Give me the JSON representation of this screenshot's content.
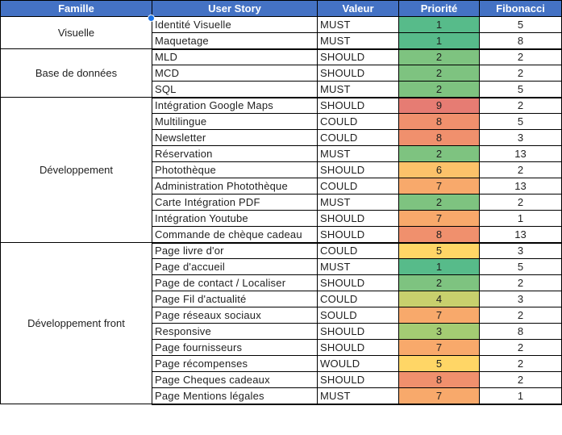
{
  "headers": {
    "famille": "Famille",
    "user_story": "User Story",
    "valeur": "Valeur",
    "priorite": "Priorité",
    "fibonacci": "Fibonacci"
  },
  "header_color": "#4472c4",
  "priority_colors": {
    "1": "#57bb8a",
    "2": "#7ec380",
    "3": "#a4cc73",
    "4": "#c8d06d",
    "5": "#ffd666",
    "6": "#fcc26a",
    "7": "#f8a96b",
    "8": "#f0906d",
    "9": "#e67c73"
  },
  "groups": [
    {
      "famille": "Visuelle",
      "rows": [
        {
          "story": "Identité Visuelle",
          "valeur": "MUST",
          "priorite": "1",
          "fibonacci": "5"
        },
        {
          "story": "Maquetage",
          "valeur": "MUST",
          "priorite": "1",
          "fibonacci": "8"
        }
      ]
    },
    {
      "famille": "Base de données",
      "rows": [
        {
          "story": "MLD",
          "valeur": "SHOULD",
          "priorite": "2",
          "fibonacci": "2"
        },
        {
          "story": "MCD",
          "valeur": "SHOULD",
          "priorite": "2",
          "fibonacci": "2"
        },
        {
          "story": "SQL",
          "valeur": "MUST",
          "priorite": "2",
          "fibonacci": "5"
        }
      ]
    },
    {
      "famille": "Développement",
      "rows": [
        {
          "story": "Intégration Google Maps",
          "valeur": "SHOULD",
          "priorite": "9",
          "fibonacci": "2"
        },
        {
          "story": "Multilingue",
          "valeur": "COULD",
          "priorite": "8",
          "fibonacci": "5"
        },
        {
          "story": "Newsletter",
          "valeur": "COULD",
          "priorite": "8",
          "fibonacci": "3"
        },
        {
          "story": "Réservation",
          "valeur": "MUST",
          "priorite": "2",
          "fibonacci": "13"
        },
        {
          "story": "Photothèque",
          "valeur": "SHOULD",
          "priorite": "6",
          "fibonacci": "2"
        },
        {
          "story": "Administration Photothèque",
          "valeur": "COULD",
          "priorite": "7",
          "fibonacci": "13"
        },
        {
          "story": "Carte Intégration PDF",
          "valeur": "MUST",
          "priorite": "2",
          "fibonacci": "2"
        },
        {
          "story": "Intégration Youtube",
          "valeur": "SHOULD",
          "priorite": "7",
          "fibonacci": "1"
        },
        {
          "story": "Commande de chèque cadeau",
          "valeur": "SHOULD",
          "priorite": "8",
          "fibonacci": "13"
        }
      ]
    },
    {
      "famille": "Développement front",
      "rows": [
        {
          "story": "Page livre d'or",
          "valeur": "COULD",
          "priorite": "5",
          "fibonacci": "3"
        },
        {
          "story": "Page d'accueil",
          "valeur": "MUST",
          "priorite": "1",
          "fibonacci": "5"
        },
        {
          "story": "Page de contact / Localiser",
          "valeur": "SHOULD",
          "priorite": "2",
          "fibonacci": "2"
        },
        {
          "story": "Page Fil d'actualité",
          "valeur": "COULD",
          "priorite": "4",
          "fibonacci": "3"
        },
        {
          "story": "Page réseaux sociaux",
          "valeur": "SOULD",
          "priorite": "7",
          "fibonacci": "2"
        },
        {
          "story": "Responsive",
          "valeur": "SHOULD",
          "priorite": "3",
          "fibonacci": "8"
        },
        {
          "story": "Page fournisseurs",
          "valeur": "SHOULD",
          "priorite": "7",
          "fibonacci": "2"
        },
        {
          "story": "Page récompenses",
          "valeur": "WOULD",
          "priorite": "5",
          "fibonacci": "2"
        },
        {
          "story": "Page Cheques cadeaux",
          "valeur": "SHOULD",
          "priorite": "8",
          "fibonacci": "2"
        },
        {
          "story": "Page Mentions légales",
          "valeur": "MUST",
          "priorite": "7",
          "fibonacci": "1"
        }
      ]
    }
  ]
}
